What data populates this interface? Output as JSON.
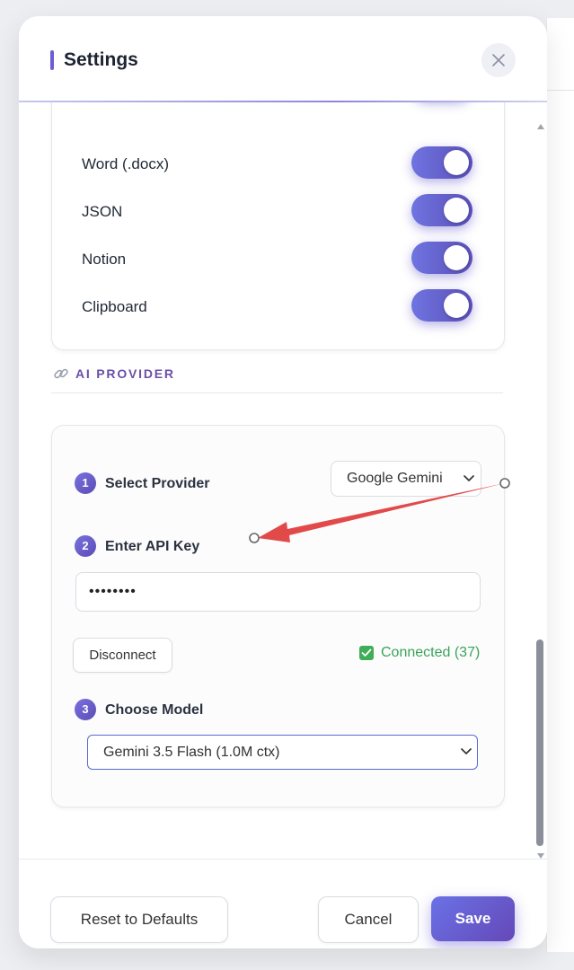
{
  "dialog": {
    "title": "Settings",
    "close_icon": "close-icon"
  },
  "export_targets": [
    {
      "label": "Word (.docx)",
      "enabled": true
    },
    {
      "label": "JSON",
      "enabled": true
    },
    {
      "label": "Notion",
      "enabled": true
    },
    {
      "label": "Clipboard",
      "enabled": true
    }
  ],
  "ai_provider": {
    "section_title": "AI PROVIDER",
    "section_icon": "link-icon",
    "steps": [
      {
        "number": "1",
        "label": "Select Provider"
      },
      {
        "number": "2",
        "label": "Enter API Key"
      },
      {
        "number": "3",
        "label": "Choose Model"
      }
    ],
    "provider_value": "Google Gemini",
    "api_key_value": "••••••••",
    "disconnect_label": "Disconnect",
    "status_text": "Connected (37)",
    "model_value": "Gemini 3.5 Flash (1.0M ctx)"
  },
  "footer": {
    "reset_label": "Reset to Defaults",
    "cancel_label": "Cancel",
    "save_label": "Save"
  },
  "colors": {
    "accent": "#6b5fd3",
    "toggle_on": "#5b4fb8",
    "success": "#3aa35a",
    "annotation_arrow": "#e04848"
  }
}
